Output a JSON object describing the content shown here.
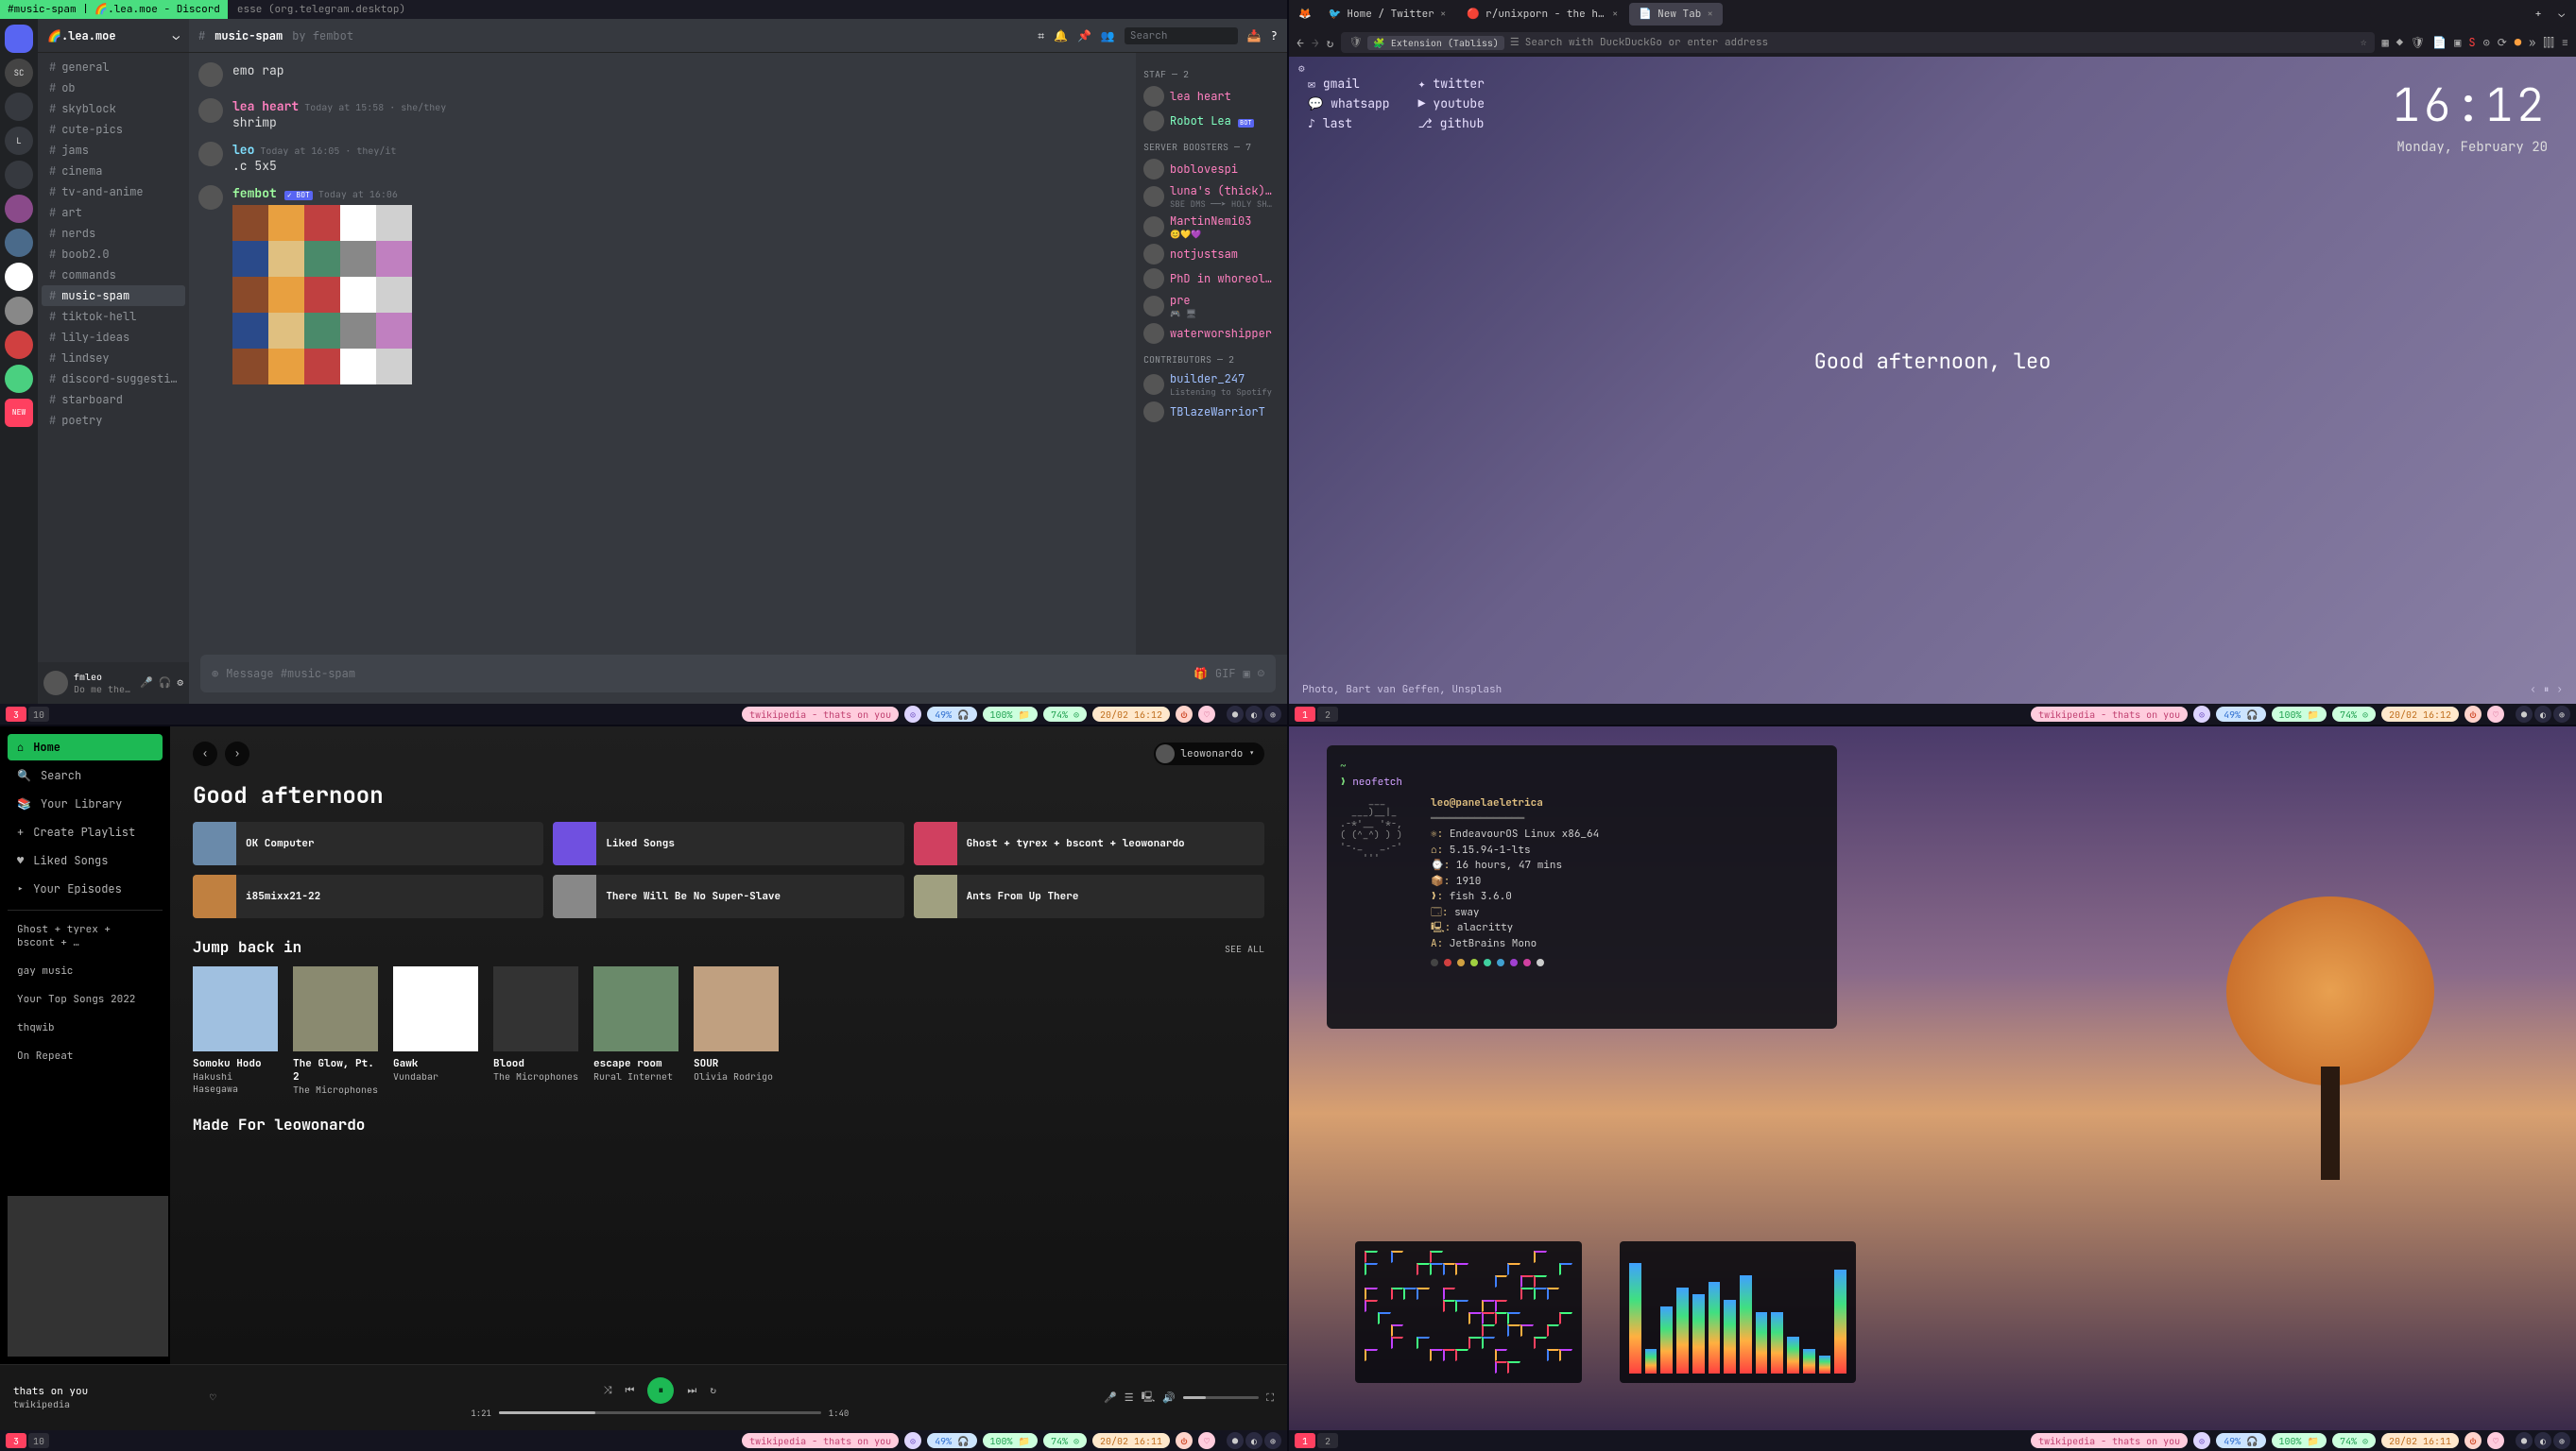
{
  "statusbar": {
    "workspaces": [
      "3",
      "10"
    ],
    "workspaces2": [
      "1",
      "2"
    ],
    "now_playing": "twikipedia - thats on you",
    "battery": "49% 🎧",
    "disk": "100% 📁",
    "cpu": "74% ⊙",
    "datetime": "20/02 16:12",
    "datetime2": "20/02 16:11"
  },
  "discord": {
    "titlebar_active": "#music-spam | 🌈.lea.moe - Discord",
    "titlebar_inactive": "esse (org.telegram.desktop)",
    "server_name": "🌈.lea.moe",
    "server_initials": [
      "",
      "SC",
      "",
      "L",
      "",
      "",
      "",
      "",
      "",
      "",
      ""
    ],
    "channels": [
      "general",
      "ob",
      "skyblock",
      "cute-pics",
      "jams",
      "cinema",
      "tv-and-anime",
      "art",
      "nerds",
      "boob2.0",
      "commands",
      "music-spam",
      "tiktok-hell",
      "lily-ideas",
      "lindsey",
      "discord-suggesti…",
      "starboard",
      "poetry"
    ],
    "selected_channel": "music-spam",
    "topbar_channel": "music-spam",
    "topbar_topic": "by fembot",
    "search_placeholder": "Search",
    "messages": [
      {
        "author": "",
        "author_color": "#fff",
        "time": "",
        "content": "emo rap"
      },
      {
        "author": "lea heart",
        "author_color": "#ff80c0",
        "time": "Today at 15:58 · she/they",
        "content": "shrimp"
      },
      {
        "author": "leo",
        "author_color": "#80e0ff",
        "time": "Today at 16:05 · they/it",
        "content": ".c 5x5"
      },
      {
        "author": "fembot",
        "author_color": "#a0ffa0",
        "badge": "BOT",
        "time": "Today at 16:06",
        "content": ""
      }
    ],
    "input_placeholder": "Message #music-spam",
    "member_groups": [
      {
        "label": "STAF — 2",
        "members": [
          {
            "name": "lea heart",
            "color": "#ff80c0"
          },
          {
            "name": "Robot Lea",
            "color": "#80ffc0",
            "badge": "BOT"
          }
        ]
      },
      {
        "label": "SERVER BOOSTERS — 7",
        "members": [
          {
            "name": "boblovespi",
            "color": "#ff80c0"
          },
          {
            "name": "luna's (thick)…",
            "color": "#ff80c0",
            "sub": "SBE DMS ──➤ HOLY SH…"
          },
          {
            "name": "MartinNemi03",
            "color": "#ff80c0",
            "sub": "😊💛💜"
          },
          {
            "name": "notjustsam",
            "color": "#ff80c0"
          },
          {
            "name": "PhD in whoreol…",
            "color": "#ff80c0"
          },
          {
            "name": "pre",
            "color": "#ff80c0",
            "sub": "🎮 🖥"
          },
          {
            "name": "waterworshipper",
            "color": "#ff80c0"
          }
        ]
      },
      {
        "label": "CONTRIBUTORS — 2",
        "members": [
          {
            "name": "builder_247",
            "color": "#a0c0ff",
            "sub": "Listening to Spotify"
          },
          {
            "name": "TBlazeWarriorT",
            "color": "#a0c0ff"
          }
        ]
      }
    ],
    "user_panel": {
      "name": "fmleo",
      "status": "Do me the…"
    }
  },
  "firefox": {
    "tabs": [
      {
        "icon": "🐦",
        "label": "Home / Twitter",
        "active": false
      },
      {
        "icon": "🔴",
        "label": "r/unixporn - the home for",
        "active": false
      },
      {
        "icon": "📄",
        "label": "New Tab",
        "active": true
      }
    ],
    "url_extension": "Extension (Tabliss)",
    "url_placeholder": "Search with DuckDuckGo or enter address",
    "tabliss": {
      "links_left": [
        {
          "icon": "✉",
          "label": "gmail"
        },
        {
          "icon": "💬",
          "label": "whatsapp"
        },
        {
          "icon": "♪",
          "label": "last"
        }
      ],
      "links_right": [
        {
          "icon": "✦",
          "label": "twitter"
        },
        {
          "icon": "▶",
          "label": "youtube"
        },
        {
          "icon": "⎇",
          "label": "github"
        }
      ],
      "time": "16:12",
      "date": "Monday, February 20",
      "greeting": "Good afternoon, leo",
      "credit": "Photo, Bart van Geffen, Unsplash"
    }
  },
  "spotify": {
    "nav": [
      "Home",
      "Search",
      "Your Library",
      "Create Playlist",
      "Liked Songs",
      "Your Episodes"
    ],
    "playlists": [
      "Ghost + tyrex + bscont + …",
      "gay music",
      "Your Top Songs 2022",
      "thqwib",
      "On Repeat"
    ],
    "user": "leowonardo",
    "greeting": "Good afternoon",
    "top_cards": [
      {
        "title": "OK Computer"
      },
      {
        "title": "Liked Songs"
      },
      {
        "title": "Ghost + tyrex + bscont + leowonardo"
      },
      {
        "title": "i85mixx21-22"
      },
      {
        "title": "There Will Be No Super-Slave"
      },
      {
        "title": "Ants From Up There"
      }
    ],
    "section1": {
      "title": "Jump back in",
      "see": "SEE ALL"
    },
    "albums": [
      {
        "title": "Somoku Hodo",
        "artist": "Hakushi Hasegawa"
      },
      {
        "title": "The Glow, Pt. 2",
        "artist": "The Microphones"
      },
      {
        "title": "Gawk",
        "artist": "Vundabar"
      },
      {
        "title": "Blood",
        "artist": "The Microphones"
      },
      {
        "title": "escape room",
        "artist": "Rural Internet"
      },
      {
        "title": "SOUR",
        "artist": "Olivia Rodrigo"
      }
    ],
    "section2": "Made For leowonardo",
    "now_playing": {
      "title": "thats on you",
      "artist": "twikipedia"
    },
    "progress": {
      "elapsed": "1:21",
      "total": "1:40"
    }
  },
  "terminal": {
    "prompt": "~",
    "command": "neofetch",
    "user_host": "leo@panelaeletrica",
    "info": [
      {
        "k": "⚛",
        "v": "EndeavourOS Linux x86_64"
      },
      {
        "k": "⌂",
        "v": "5.15.94-1-lts"
      },
      {
        "k": "⌚",
        "v": "16 hours, 47 mins"
      },
      {
        "k": "📦",
        "v": "1910"
      },
      {
        "k": "❯",
        "v": "fish 3.6.0"
      },
      {
        "k": "🗔",
        "v": "sway"
      },
      {
        "k": "🖳",
        "v": "alacritty"
      },
      {
        "k": "A",
        "v": "JetBrains Mono"
      }
    ],
    "ascii": "     ___\n  ___)__|_\n.-*'__ '*-,\n( (^_^) ) )\n'-._   _.-'\n    '''",
    "cava_heights": [
      90,
      20,
      55,
      70,
      65,
      75,
      60,
      80,
      50,
      50,
      30,
      20,
      15,
      85
    ]
  }
}
